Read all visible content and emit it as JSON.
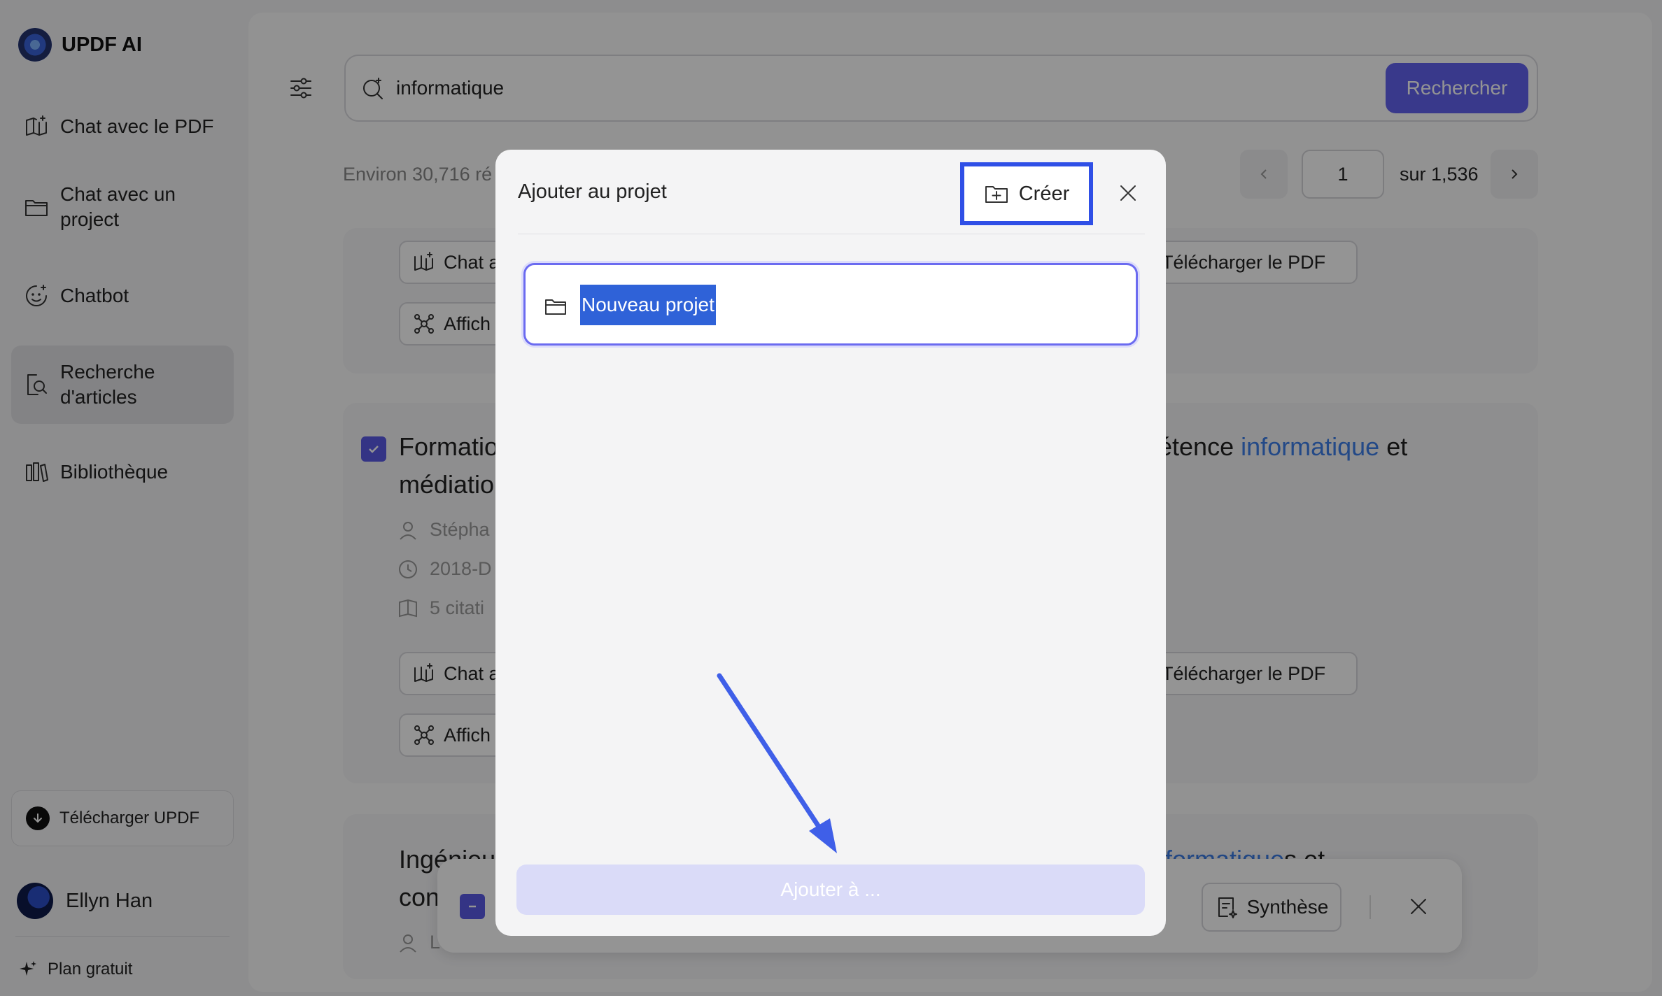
{
  "brand": {
    "name": "UPDF AI"
  },
  "sidebar": {
    "items": [
      {
        "label": "Chat avec le PDF",
        "icon": "book-sparkle-icon"
      },
      {
        "label": "Chat avec un\nproject",
        "icon": "folder-chat-icon"
      },
      {
        "label": "Chatbot",
        "icon": "bot-icon"
      },
      {
        "label": "Recherche\nd'articles",
        "icon": "search-document-icon",
        "active": true
      },
      {
        "label": "Bibliothèque",
        "icon": "library-icon"
      }
    ],
    "download_label": "Télécharger UPDF",
    "user_name": "Ellyn Han",
    "plan_label": "Plan gratuit"
  },
  "search": {
    "value": "informatique",
    "button_label": "Rechercher"
  },
  "results": {
    "count_text": "Environ 30,716 ré"
  },
  "pagination": {
    "current_page": "1",
    "total_text": "sur 1,536"
  },
  "cards": [
    {
      "actions": {
        "chat": "Chat a",
        "show": "Affich",
        "download": "Télécharger le PDF"
      }
    },
    {
      "title_line1_start": "Formatio",
      "title_line1_end_prefix": "étence ",
      "title_highlight": "informatique",
      "title_line1_end_suffix": " et",
      "title_line2": "médiatio",
      "author": "Stépha",
      "date": "2018-D",
      "citations": "5 citati",
      "actions": {
        "chat": "Chat a",
        "show": "Affich",
        "download": "Télécharger le PDF"
      }
    },
    {
      "title_line1_start": "Ingénieu",
      "title_highlight_partial": "formatique",
      "title_suffix": "s et",
      "title_line2": "con",
      "author": "L"
    }
  ],
  "bottom_bar": {
    "synthesis_label": "Synthèse"
  },
  "modal": {
    "title": "Ajouter au projet",
    "create_label": "Créer",
    "project_name": "Nouveau projet",
    "add_to_label": "Ajouter à ..."
  },
  "colors": {
    "accent": "#6363f0",
    "highlight_border": "#2f4fe6",
    "link": "#3d7ee8"
  }
}
